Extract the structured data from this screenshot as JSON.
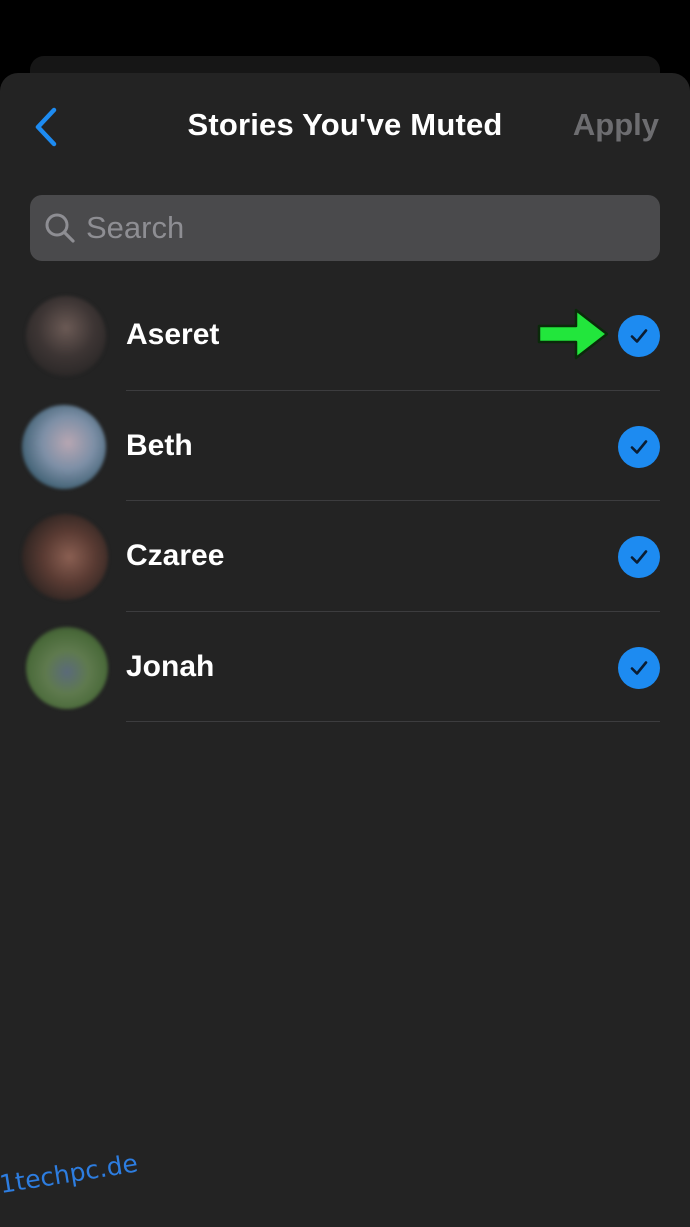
{
  "header": {
    "title": "Stories You've Muted",
    "apply_label": "Apply",
    "back_icon": "chevron-left-icon"
  },
  "search": {
    "placeholder": "Search",
    "value": "",
    "icon": "magnifying-glass-icon"
  },
  "contacts": [
    {
      "name": "Aseret",
      "checked": true
    },
    {
      "name": "Beth",
      "checked": true
    },
    {
      "name": "Czaree",
      "checked": true
    },
    {
      "name": "Jonah",
      "checked": true
    }
  ],
  "annotation": {
    "arrow_color": "#22e63c",
    "points_to": "Aseret checkmark"
  },
  "watermark": "1techpc.de",
  "colors": {
    "accent": "#1d8bf1",
    "background": "#232323",
    "apply_disabled": "#6d6d70",
    "search_field": "#4a4a4c"
  }
}
